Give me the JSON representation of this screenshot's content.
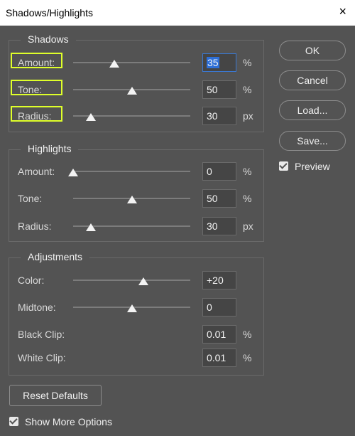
{
  "window": {
    "title": "Shadows/Highlights",
    "close_glyph": "×"
  },
  "shadows": {
    "legend": "Shadows",
    "amount": {
      "label": "Amount:",
      "value": "35",
      "unit": "%",
      "slider": 0.35
    },
    "tone": {
      "label": "Tone:",
      "value": "50",
      "unit": "%",
      "slider": 0.5
    },
    "radius": {
      "label": "Radius:",
      "value": "30",
      "unit": "px",
      "slider": 0.15
    }
  },
  "highlights": {
    "legend": "Highlights",
    "amount": {
      "label": "Amount:",
      "value": "0",
      "unit": "%",
      "slider": 0.0
    },
    "tone": {
      "label": "Tone:",
      "value": "50",
      "unit": "%",
      "slider": 0.5
    },
    "radius": {
      "label": "Radius:",
      "value": "30",
      "unit": "px",
      "slider": 0.15
    }
  },
  "adjustments": {
    "legend": "Adjustments",
    "color": {
      "label": "Color:",
      "value": "+20",
      "slider": 0.6
    },
    "midtone": {
      "label": "Midtone:",
      "value": "0",
      "slider": 0.5
    },
    "black_clip": {
      "label": "Black Clip:",
      "value": "0.01",
      "unit": "%"
    },
    "white_clip": {
      "label": "White Clip:",
      "value": "0.01",
      "unit": "%"
    }
  },
  "buttons": {
    "ok": "OK",
    "cancel": "Cancel",
    "load": "Load...",
    "save": "Save...",
    "reset": "Reset Defaults"
  },
  "options": {
    "preview": "Preview",
    "preview_checked": true,
    "show_more": "Show More Options",
    "show_more_checked": true
  },
  "colors": {
    "highlight_box": "#dfff2a",
    "selection": "#2d6fd8",
    "background": "#535353"
  }
}
